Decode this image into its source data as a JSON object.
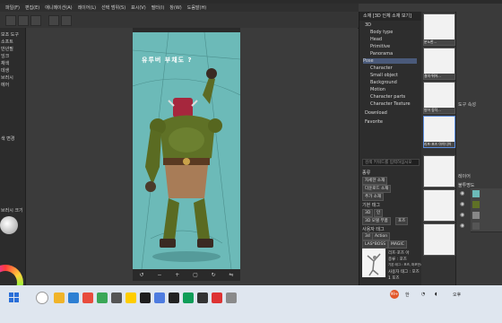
{
  "menubar": {
    "items": [
      "파일(F)",
      "편집(E)",
      "애니메이션(A)",
      "레이어(L)",
      "선택 범위(S)",
      "표시(V)",
      "필터(I)",
      "창(W)",
      "도움말(H)"
    ]
  },
  "left_panel": {
    "items": [
      "보조 도구",
      "소프트",
      "만년필",
      "잉크",
      "채색",
      "데생",
      "브러시",
      "에어",
      "색 변경"
    ],
    "size_label": "브러시 크기"
  },
  "canvas": {
    "handwriting": "유투버 부채도 ?",
    "bg_color": "#6cbab8"
  },
  "material_panel": {
    "header": "소재 [3D 인체 소재 보기]",
    "tree": [
      "3D",
      "Body type",
      "Head",
      "Primitive",
      "Panorama",
      "Pose",
      "Character",
      "Small object",
      "Background",
      "Motion",
      "Character parts",
      "Character Texture",
      "Download",
      "Favorite"
    ],
    "selected": "Pose",
    "search_placeholder": "검색 키워드를 입력하십시오",
    "sections": {
      "kind_label": "종류",
      "buttons": [
        "자세한 소재",
        "다운로드 소재",
        "추가 소재"
      ],
      "tag_label": "기본 태그",
      "tags": [
        "3D",
        "인",
        "3D 모델 부품",
        "포즈"
      ],
      "user_tag_label": "사용자 태그",
      "user_tags": [
        "3d",
        "Action",
        "LAS*BOSS",
        "MAGIC",
        "MAGICIDER",
        "POSE"
      ]
    },
    "preview_info": {
      "title": "리프·포즈 아",
      "kind": "종류 : 포즈",
      "detail": "기본 태그 : 포즈, 퍼포먼스, 리프레시 [3]",
      "user": "사용자 태그 : 포즈",
      "count": "1 포즈"
    }
  },
  "thumbnails": [
    {
      "label": "분노한..."
    },
    {
      "label": "결의·뛰어..."
    },
    {
      "label": "방어 동작..."
    },
    {
      "label": "리프·포즈 아이디어"
    },
    {
      "label": ""
    },
    {
      "label": ""
    },
    {
      "label": ""
    }
  ],
  "right_panel": {
    "labels": [
      "도구 속성",
      "레이어",
      "불투명도"
    ]
  },
  "taskbar": {
    "notif_count": "99+",
    "lang": "한",
    "time": "오후"
  }
}
